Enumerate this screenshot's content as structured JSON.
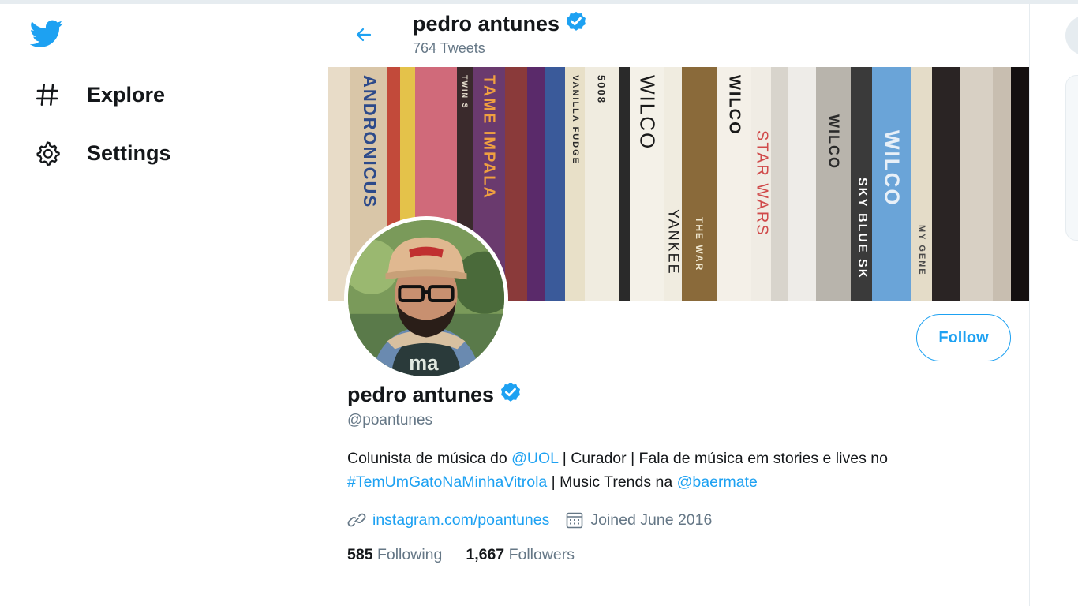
{
  "nav": {
    "explore_label": "Explore",
    "settings_label": "Settings"
  },
  "header": {
    "name": "pedro antunes",
    "tweets_count": "764 Tweets"
  },
  "banner": {
    "spines": [
      "ANDRONICUS",
      "TAME IMPALA",
      "TWIN S",
      "5008",
      "VANILLA FUDGE",
      "WILCO",
      "YANKEE",
      "THE WAR",
      "WILCO",
      "STAR WARS",
      "WILCO",
      "SKY BLUE SK",
      "WILCO",
      "MY GENE"
    ]
  },
  "profile": {
    "name": "pedro antunes",
    "handle": "@poantunes",
    "follow_label": "Follow",
    "bio": {
      "part1": "Colunista de música do ",
      "mention1": "@UOL",
      "part2": " | Curador | Fala de música em stories e lives no ",
      "hashtag": "#TemUmGatoNaMinhaVitrola",
      "part3": " | Music Trends na ",
      "mention2": "@baermate"
    },
    "website": "instagram.com/poantunes",
    "joined": "Joined June 2016",
    "following_count": "585",
    "following_label": "Following",
    "followers_count": "1,667",
    "followers_label": "Followers"
  },
  "colors": {
    "accent": "#1da1f2",
    "text": "#14171a",
    "muted": "#657786"
  }
}
